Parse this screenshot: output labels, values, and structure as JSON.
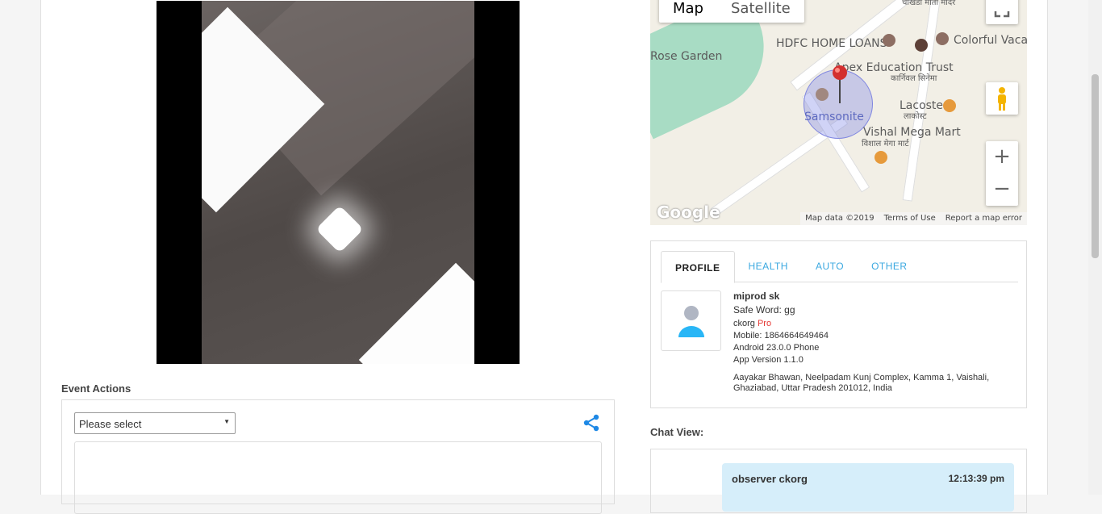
{
  "event_actions": {
    "title": "Event Actions",
    "select_value": "Please select"
  },
  "map": {
    "type_map": "Map",
    "type_satellite": "Satellite",
    "labels": {
      "hdfc": "HDFC HOME LOANS",
      "colorful": "Colorful Vacati",
      "rose": "Rose Garden",
      "apex": "Apex Education Trust",
      "apex_hi": "कार्निवल सिनेमा",
      "samsonite": "Samsonite",
      "lacoste": "Lacoste",
      "lacoste_hi": "लाकोस्ट",
      "vishal": "Vishal Mega Mart",
      "vishal_hi": "विशाल मेगा मार्ट",
      "temple_hi": "चौखंडी माता मंदिर"
    },
    "google": "Google",
    "attribution": {
      "data": "Map data ©2019",
      "terms": "Terms of Use",
      "report": "Report a map error"
    }
  },
  "profile": {
    "tabs": [
      "PROFILE",
      "HEALTH",
      "AUTO",
      "OTHER"
    ],
    "name": "miprod sk",
    "safe_word": "Safe Word: gg",
    "org": "ckorg",
    "plan": "Pro",
    "mobile": "Mobile: 1864664649464",
    "device": "Android 23.0.0 Phone",
    "app_version": "App Version 1.1.0",
    "address": "Aayakar Bhawan, Neelpadam Kunj Complex, Kamma 1, Vaishali, Ghaziabad, Uttar Pradesh 201012, India"
  },
  "chat": {
    "title": "Chat View:",
    "messages": [
      {
        "sender": "observer ckorg",
        "time": "12:13:39 pm"
      }
    ]
  }
}
